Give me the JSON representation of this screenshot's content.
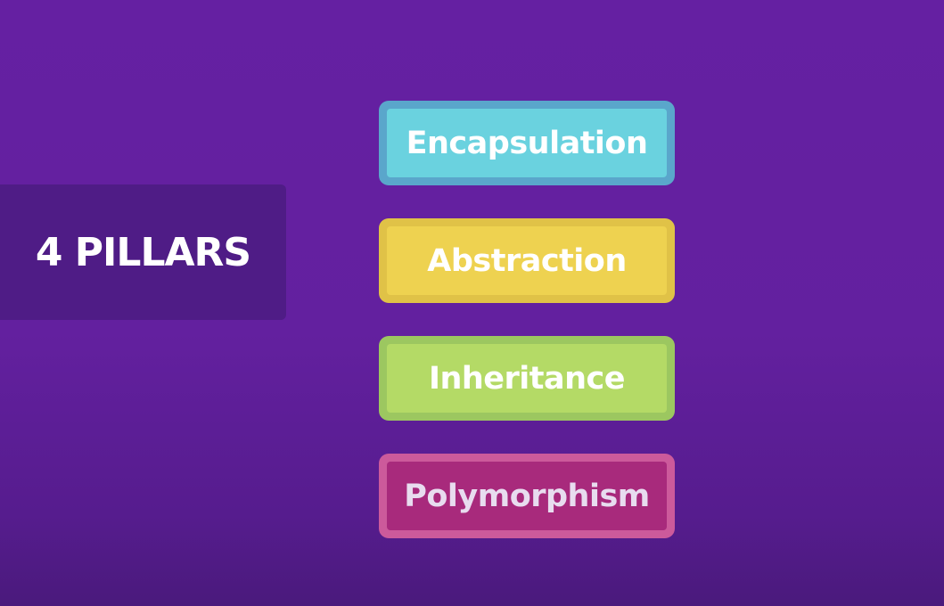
{
  "heading": {
    "label": "4 PILLARS",
    "panel_color": "#4f1c86"
  },
  "pillars": [
    {
      "label": "Encapsulation",
      "outer_color": "#5aa6cb",
      "inner_color": "#6ad2df",
      "text_color": "#ffffff"
    },
    {
      "label": "Abstraction",
      "outer_color": "#e0c247",
      "inner_color": "#eed250",
      "text_color": "#ffffff"
    },
    {
      "label": "Inheritance",
      "outer_color": "#9cc760",
      "inner_color": "#b4da66",
      "text_color": "#ffffff"
    },
    {
      "label": "Polymorphism",
      "outer_color": "#cc5a9b",
      "inner_color": "#a82a7c",
      "text_color": "#e8dcef"
    }
  ],
  "colors": {
    "background_top": "#6520a2",
    "background_bottom": "#4a1a7c"
  }
}
